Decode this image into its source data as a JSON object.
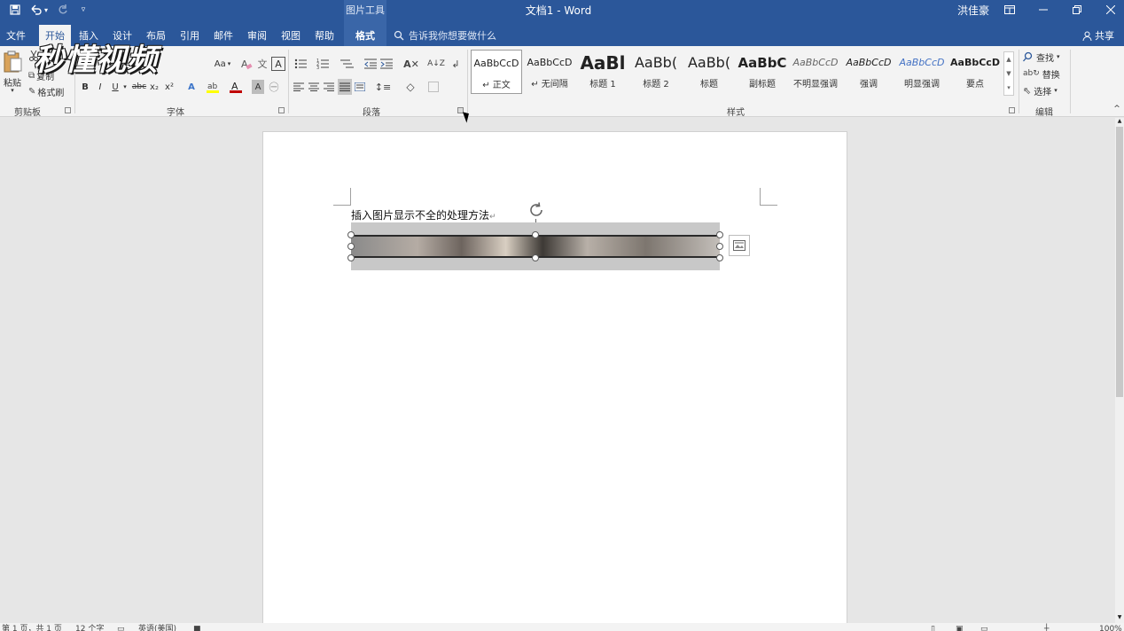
{
  "titlebar": {
    "document_title": "文档1  -  Word",
    "context_group": "图片工具",
    "user": "洪佳豪",
    "icons": [
      "save-icon",
      "undo-icon",
      "redo-icon",
      "customize-qat-icon",
      "ribbon-display-icon",
      "minimize-icon",
      "restore-icon",
      "close-icon"
    ]
  },
  "tabs": [
    {
      "label": "文件"
    },
    {
      "label": "开始"
    },
    {
      "label": "插入"
    },
    {
      "label": "设计"
    },
    {
      "label": "布局"
    },
    {
      "label": "引用"
    },
    {
      "label": "邮件"
    },
    {
      "label": "审阅"
    },
    {
      "label": "视图"
    },
    {
      "label": "帮助"
    },
    {
      "label": "格式"
    }
  ],
  "active_tab": "开始",
  "tellme": {
    "placeholder": "告诉我你想要做什么"
  },
  "share": {
    "label": "共享"
  },
  "clipboard": {
    "paste": "粘贴",
    "cut_icon": "scissors-icon",
    "copy": "复制",
    "format_painter": "格式刷",
    "group_label": "剪贴板"
  },
  "font": {
    "font_size_label": "Aa",
    "group_label": "字体",
    "buttons": [
      "B",
      "I",
      "U",
      "abc",
      "x₂",
      "x²",
      "A",
      "A"
    ]
  },
  "paragraph": {
    "group_label": "段落"
  },
  "styles": {
    "group_label": "样式",
    "items": [
      {
        "sample": "AaBbCcD",
        "name": "正文",
        "mark": "↵"
      },
      {
        "sample": "AaBbCcD",
        "name": "无间隔",
        "mark": "↵"
      },
      {
        "sample": "AaBl",
        "name": "标题 1"
      },
      {
        "sample": "AaBb(",
        "name": "标题 2"
      },
      {
        "sample": "AaBb(",
        "name": "标题"
      },
      {
        "sample": "AaBbC",
        "name": "副标题"
      },
      {
        "sample": "AaBbCcD",
        "name": "不明显强调"
      },
      {
        "sample": "AaBbCcD",
        "name": "强调"
      },
      {
        "sample": "AaBbCcD",
        "name": "明显强调"
      },
      {
        "sample": "AaBbCcD",
        "name": "要点"
      }
    ]
  },
  "editing": {
    "find": "查找",
    "replace": "替换",
    "select": "选择",
    "group_label": "编辑"
  },
  "document": {
    "text": "插入图片显示不全的处理方法",
    "para_mark": "↵"
  },
  "watermark": {
    "text": "秒懂视频"
  },
  "statusbar": {
    "page": "第 1 页，共 1 页",
    "words": "12 个字",
    "language": "英语(美国)",
    "zoom": "100%"
  },
  "colors": {
    "brand": "#2b579a",
    "ribbon_bg": "#f3f3f3",
    "doc_bg": "#e6e6e6",
    "highlight": "#ffff00",
    "font_color": "#c00000"
  }
}
